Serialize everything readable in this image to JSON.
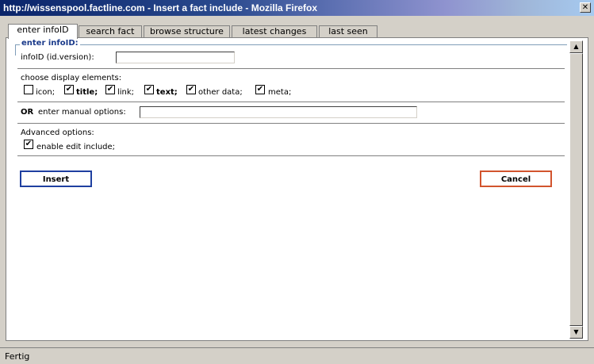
{
  "window": {
    "title": "http://wissenspool.factline.com - Insert a fact include - Mozilla Firefox",
    "close_glyph": "✕"
  },
  "tabs": [
    {
      "label": "enter infoID",
      "active": true
    },
    {
      "label": "search fact",
      "active": false
    },
    {
      "label": "browse structure",
      "active": false
    },
    {
      "label": "latest changes",
      "active": false
    },
    {
      "label": "last seen",
      "active": false
    }
  ],
  "form": {
    "legend": "enter infoID:",
    "infoid_label": "infoID (id.version):",
    "infoid_value": "",
    "display_label": "choose display elements:",
    "elements": [
      {
        "label": "icon;",
        "checked": false,
        "bold": false
      },
      {
        "label": "title;",
        "checked": true,
        "bold": true
      },
      {
        "label": "link;",
        "checked": true,
        "bold": false
      },
      {
        "label": "text;",
        "checked": true,
        "bold": true
      },
      {
        "label": "other data;",
        "checked": true,
        "bold": false
      },
      {
        "label": "meta;",
        "checked": true,
        "bold": false
      }
    ],
    "manual_or": "OR",
    "manual_label": "enter manual options:",
    "manual_value": "",
    "advanced_label": "Advanced options:",
    "edit_include": {
      "label": "enable edit include;",
      "checked": true
    },
    "check_glyph": "✔"
  },
  "buttons": {
    "insert": "Insert",
    "cancel": "Cancel"
  },
  "scrollbar": {
    "up": "▲",
    "down": "▼"
  },
  "status": {
    "text": "Fertig"
  }
}
